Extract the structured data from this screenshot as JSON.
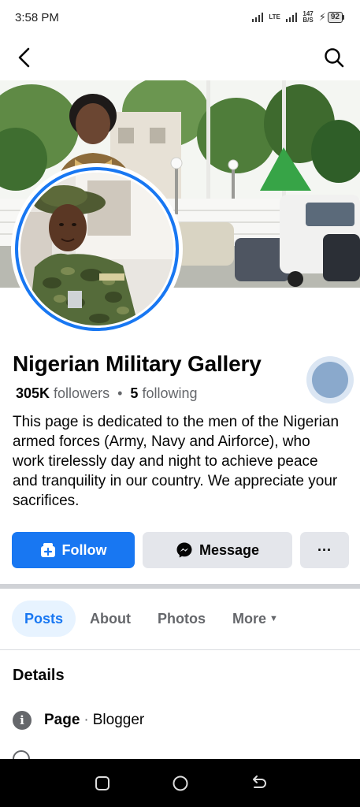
{
  "status_bar": {
    "time": "3:58 PM",
    "network": "LTE",
    "speed_top": "147",
    "speed_bottom": "B/S",
    "battery": "92"
  },
  "top_nav": {
    "back_icon": "back-arrow-icon",
    "search_icon": "search-icon"
  },
  "page": {
    "name": "Nigerian Military Gallery",
    "followers_count": "305K",
    "followers_label": "followers",
    "following_count": "5",
    "following_label": "following",
    "bio": "This page is dedicated to the men of the Nigerian armed forces (Army, Navy and Airforce), who work tirelessly day and night to achieve peace and tranquility in our country. We appreciate your sacrifices."
  },
  "actions": {
    "follow_label": "Follow",
    "message_label": "Message",
    "more_label": "···"
  },
  "tabs": [
    {
      "label": "Posts",
      "active": true
    },
    {
      "label": "About",
      "active": false
    },
    {
      "label": "Photos",
      "active": false
    },
    {
      "label": "More",
      "active": false
    }
  ],
  "details": {
    "title": "Details",
    "page_label": "Page",
    "separator": "·",
    "category": "Blogger"
  },
  "colors": {
    "accent": "#1877f2",
    "button_grey": "#e4e6eb",
    "muted_text": "#65676b"
  }
}
